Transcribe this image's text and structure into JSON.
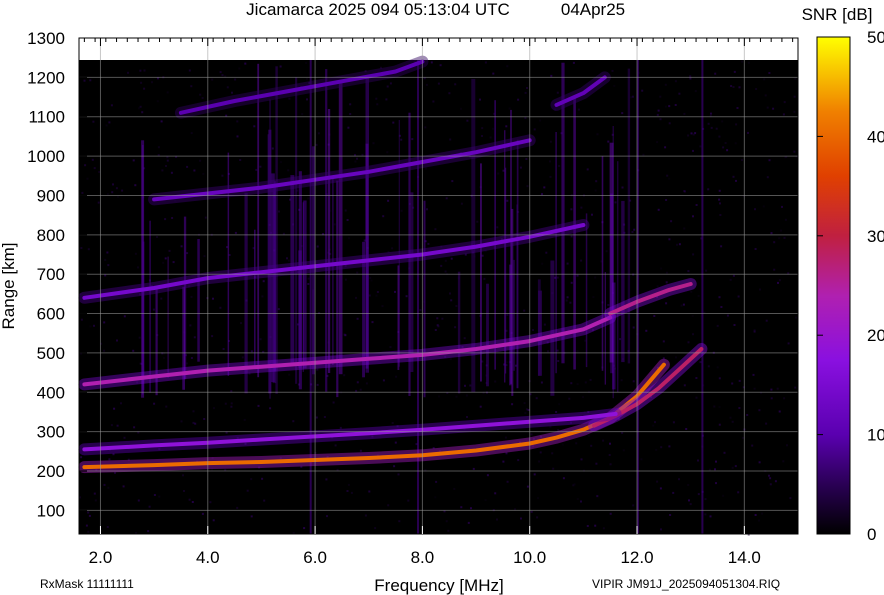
{
  "chart_data": {
    "type": "heatmap",
    "title": "Jicamarca 2025 094 05:13:04 UTC",
    "date": "04Apr25",
    "xlabel": "Frequency [MHz]",
    "ylabel": "Range [km]",
    "xlim": [
      1.6,
      15.0
    ],
    "ylim": [
      40,
      1300
    ],
    "x_ticks": [
      2.0,
      4.0,
      6.0,
      8.0,
      10.0,
      12.0,
      14.0
    ],
    "x_tick_labels": [
      "2.0",
      "4.0",
      "6.0",
      "8.0",
      "10.0",
      "12.0",
      "14.0"
    ],
    "y_ticks": [
      100,
      200,
      300,
      400,
      500,
      600,
      700,
      800,
      900,
      1000,
      1100,
      1200,
      1300
    ],
    "y_tick_labels": [
      "100",
      "200",
      "300",
      "400",
      "500",
      "600",
      "700",
      "800",
      "900",
      "1000",
      "1100",
      "1200",
      "1300"
    ],
    "colorbar": {
      "label": "SNR [dB]",
      "range": [
        0,
        50
      ],
      "ticks": [
        0,
        10,
        20,
        30,
        40,
        50
      ],
      "tick_labels": [
        "0",
        "10",
        "20",
        "30",
        "40",
        "50"
      ],
      "colors": [
        "#000000",
        "#5a00b0",
        "#a020f0",
        "#c02060",
        "#e04000",
        "#f08000",
        "#ffff00"
      ]
    },
    "grid": true,
    "traces": [
      {
        "x": [
          1.7,
          3.0,
          4.0,
          5.0,
          6.0,
          7.0,
          8.0,
          9.0,
          10.0,
          10.5,
          11.0,
          11.5,
          12.0,
          12.5
        ],
        "y": [
          210,
          215,
          220,
          223,
          228,
          233,
          240,
          252,
          270,
          285,
          305,
          335,
          390,
          470
        ],
        "snr": 40
      },
      {
        "x": [
          11.2,
          11.6,
          12.0,
          12.4,
          12.8,
          13.2
        ],
        "y": [
          315,
          340,
          370,
          410,
          460,
          510
        ],
        "snr": 28
      },
      {
        "x": [
          1.7,
          3.0,
          4.0,
          5.0,
          6.0,
          7.0,
          8.0,
          9.0,
          10.0,
          11.0,
          11.6
        ],
        "y": [
          255,
          265,
          272,
          280,
          288,
          296,
          305,
          315,
          325,
          335,
          345
        ],
        "snr": 18
      },
      {
        "x": [
          1.7,
          3.0,
          4.0,
          5.0,
          6.0,
          7.0,
          8.0,
          9.0,
          10.0,
          11.0,
          11.5
        ],
        "y": [
          420,
          440,
          455,
          465,
          475,
          485,
          495,
          510,
          530,
          560,
          590
        ],
        "snr": 24
      },
      {
        "x": [
          11.5,
          12.0,
          12.6,
          13.0
        ],
        "y": [
          600,
          630,
          660,
          675
        ],
        "snr": 26
      },
      {
        "x": [
          1.7,
          3.0,
          4.0,
          5.0,
          6.0,
          7.0,
          8.0,
          9.0,
          10.0,
          11.0
        ],
        "y": [
          640,
          665,
          690,
          705,
          720,
          735,
          750,
          770,
          795,
          825
        ],
        "snr": 14
      },
      {
        "x": [
          3.0,
          4.0,
          5.0,
          6.0,
          7.0,
          8.0,
          9.0,
          10.0
        ],
        "y": [
          890,
          905,
          920,
          940,
          960,
          985,
          1010,
          1040
        ],
        "snr": 12
      },
      {
        "x": [
          3.5,
          4.5,
          5.5,
          6.5,
          7.5,
          8.0
        ],
        "y": [
          1110,
          1140,
          1165,
          1190,
          1215,
          1240
        ],
        "snr": 10
      },
      {
        "x": [
          10.5,
          11.0,
          11.4
        ],
        "y": [
          1130,
          1160,
          1200
        ],
        "snr": 11
      }
    ],
    "annotations": {
      "left": "RxMask 11111111",
      "right": "VIPIR  JM91J_2025094051304.RIQ"
    }
  }
}
